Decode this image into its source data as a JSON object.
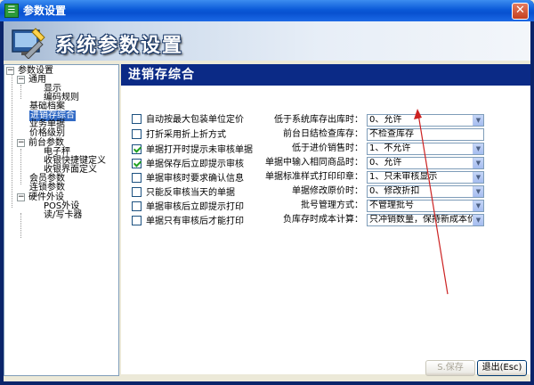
{
  "window": {
    "title": "参数设置",
    "app_icon": "app-icon",
    "close_label": "✕"
  },
  "banner": {
    "title": "系统参数设置",
    "icon": "settings-tools-icon"
  },
  "tree": {
    "items": [
      {
        "label": "参数设置",
        "expander": "−"
      },
      {
        "label": "通用",
        "expander": "−"
      },
      {
        "label": "显示"
      },
      {
        "label": "编码规则"
      },
      {
        "label": "基础档案"
      },
      {
        "label": "进销存综合"
      },
      {
        "label": "业务单据"
      },
      {
        "label": "价格级别"
      },
      {
        "label": "前台参数",
        "expander": "−"
      },
      {
        "label": "电子秤"
      },
      {
        "label": "收银快捷键定义"
      },
      {
        "label": "收银界面定义"
      },
      {
        "label": "会员参数"
      },
      {
        "label": "连锁参数"
      },
      {
        "label": "硬件外设",
        "expander": "−"
      },
      {
        "label": "POS外设"
      },
      {
        "label": "读/写卡器"
      }
    ]
  },
  "panel": {
    "title": "进销存综合",
    "checkboxes": [
      {
        "label": "自动按最大包装单位定价",
        "checked": false
      },
      {
        "label": "打折采用折上折方式",
        "checked": false
      },
      {
        "label": "单据打开时提示未审核单据",
        "checked": true
      },
      {
        "label": "单据保存后立即提示审核",
        "checked": true
      },
      {
        "label": "单据审核时要求确认信息",
        "checked": false
      },
      {
        "label": "只能反审核当天的单据",
        "checked": false
      },
      {
        "label": "单据审核后立即提示打印",
        "checked": false
      },
      {
        "label": "单据只有审核后才能打印",
        "checked": false
      }
    ],
    "fields": [
      {
        "label": "低于系统库存出库时：",
        "value": "0、允许"
      },
      {
        "label": "前台日结检查库存：",
        "value": "不检查库存"
      },
      {
        "label": "低于进价销售时：",
        "value": "1、不允许"
      },
      {
        "label": "单据中输入相同商品时：",
        "value": "0、允许"
      },
      {
        "label": "单据标准样式打印印章：",
        "value": "1、只未审核显示"
      },
      {
        "label": "单据修改原价时：",
        "value": "0、修改折扣"
      },
      {
        "label": "批号管理方式：",
        "value": "不管理批号"
      },
      {
        "label": "负库存时成本计算：",
        "value": "只冲销数量，保持新成本价"
      }
    ]
  },
  "buttons": {
    "save": "S.保存",
    "exit": "退出(Esc)"
  },
  "annotation": {
    "color": "#cc2222"
  }
}
